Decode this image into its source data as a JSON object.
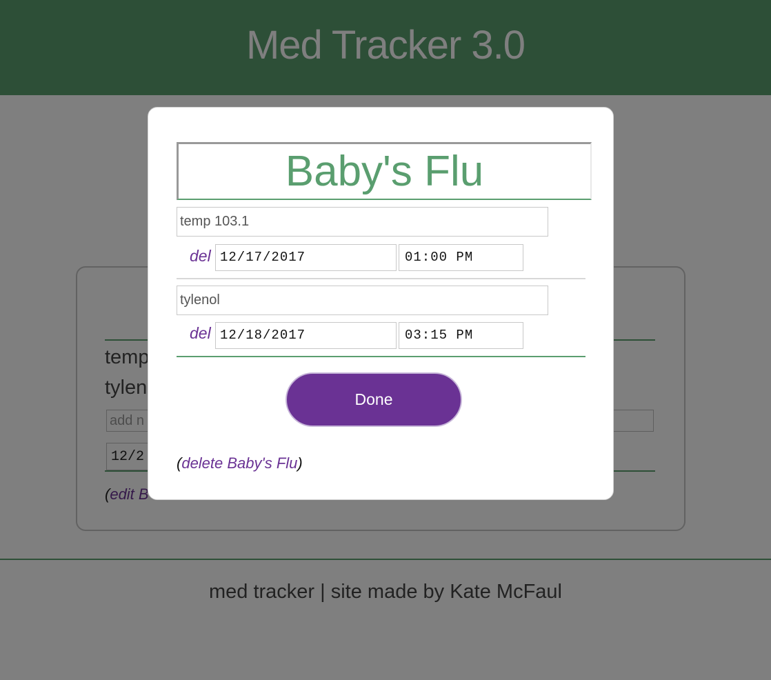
{
  "app": {
    "title": "Med Tracker 3.0"
  },
  "background_card": {
    "items": [
      "temp",
      "tylen"
    ],
    "add_placeholder": "add n",
    "date_partial": "12/2",
    "edit_link_prefix": "(",
    "edit_link_text": "edit B"
  },
  "footer": {
    "text": "med tracker | site made by Kate McFaul"
  },
  "modal": {
    "title": "Baby's Flu",
    "entries": [
      {
        "name": "temp 103.1",
        "del_label": "del",
        "date": "12/17/2017",
        "time": "01:00 PM"
      },
      {
        "name": "tylenol",
        "del_label": "del",
        "date": "12/18/2017",
        "time": "03:15 PM"
      }
    ],
    "done_label": "Done",
    "delete_prefix": "(",
    "delete_link": "delete Baby's Flu",
    "delete_suffix": ")"
  },
  "colors": {
    "header_green": "#5a9e6f",
    "accent_purple": "#6a3294",
    "overlay": "rgba(0,0,0,0.5)"
  }
}
